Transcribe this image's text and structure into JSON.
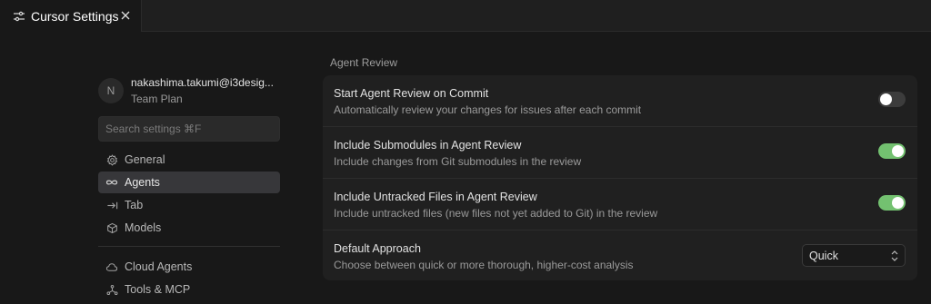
{
  "tab": {
    "title": "Cursor Settings",
    "icon": "settings-sliders-icon",
    "close_icon": "close-icon"
  },
  "sidebar": {
    "avatar_initial": "N",
    "user_email": "nakashima.takumi@i3desig...",
    "plan": "Team Plan",
    "search_placeholder": "Search settings ⌘F",
    "items": [
      {
        "label": "General",
        "icon": "gear-icon",
        "active": false
      },
      {
        "label": "Agents",
        "icon": "infinity-icon",
        "active": true
      },
      {
        "label": "Tab",
        "icon": "tab-arrow-icon",
        "active": false
      },
      {
        "label": "Models",
        "icon": "cube-icon",
        "active": false
      },
      {
        "label": "Cloud Agents",
        "icon": "cloud-icon",
        "active": false
      },
      {
        "label": "Tools & MCP",
        "icon": "tools-network-icon",
        "active": false
      }
    ]
  },
  "main": {
    "section_title": "Agent Review",
    "settings": [
      {
        "title": "Start Agent Review on Commit",
        "description": "Automatically review your changes for issues after each commit",
        "control": "toggle",
        "enabled": false
      },
      {
        "title": "Include Submodules in Agent Review",
        "description": "Include changes from Git submodules in the review",
        "control": "toggle",
        "enabled": true
      },
      {
        "title": "Include Untracked Files in Agent Review",
        "description": "Include untracked files (new files not yet added to Git) in the review",
        "control": "toggle",
        "enabled": true
      },
      {
        "title": "Default Approach",
        "description": "Choose between quick or more thorough, higher-cost analysis",
        "control": "select",
        "value": "Quick"
      }
    ]
  },
  "colors": {
    "toggle_on": "#73c170",
    "toggle_off": "#3c3c3c",
    "active_nav_bg": "#37373a",
    "background": "#181818"
  }
}
